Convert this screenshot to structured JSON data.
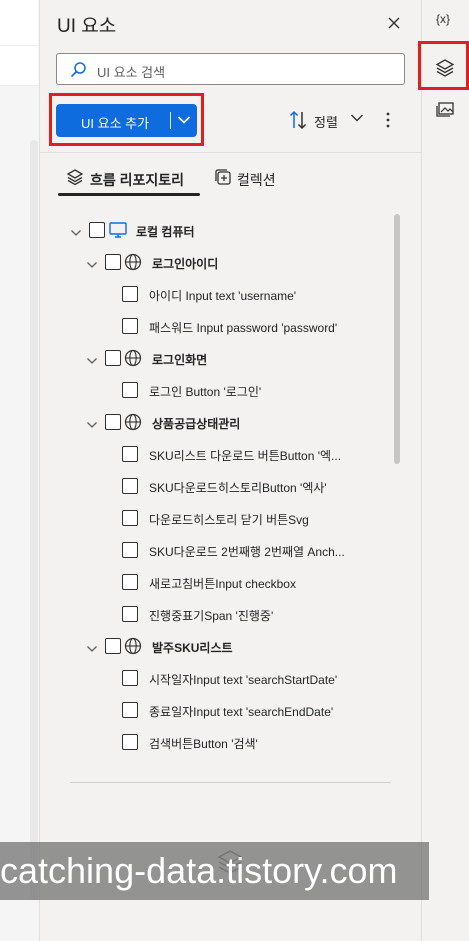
{
  "panel": {
    "title": "UI 요소",
    "search_placeholder": "UI 요소 검색",
    "add_button_label": "UI 요소 추가",
    "sort_label": "정렬"
  },
  "tabs": [
    {
      "label": "흐름 리포지토리",
      "icon": "layers-icon",
      "active": true
    },
    {
      "label": "컬렉션",
      "icon": "collection-add-icon",
      "active": false
    }
  ],
  "tree": {
    "root": {
      "label": "로컬 컴퓨터",
      "icon": "computer-icon"
    },
    "groups": [
      {
        "label": "로그인아이디",
        "icon": "globe-icon",
        "items": [
          "아이디 Input text 'username'",
          "패스워드 Input password 'password'"
        ]
      },
      {
        "label": "로그인화면",
        "icon": "globe-icon",
        "items": [
          "로그인 Button '로그인'"
        ]
      },
      {
        "label": "상품공급상태관리",
        "icon": "globe-icon",
        "items": [
          "SKU리스트 다운로드 버튼Button '엑...",
          "SKU다운로드히스토리Button '엑사'",
          "다운로드히스토리 닫기 버튼Svg",
          "SKU다운로드 2번째행 2번째열 Anch...",
          "새로고침버튼Input checkbox",
          "진행중표기Span '진행중'"
        ]
      },
      {
        "label": "발주SKU리스트",
        "icon": "globe-icon",
        "items": [
          "시작일자Input text 'searchStartDate'",
          "종료일자Input text 'searchEndDate'",
          "검색버튼Button '검색'"
        ]
      }
    ]
  },
  "rail": {
    "variables_label": "{x}",
    "items": [
      "variables-icon",
      "ui-elements-layers-icon",
      "images-icon"
    ]
  },
  "watermark": "catching-data.tistory.com",
  "colors": {
    "accent": "#0f6cdf",
    "highlight": "#e0201b",
    "panel_bg": "#f3f2f1"
  }
}
